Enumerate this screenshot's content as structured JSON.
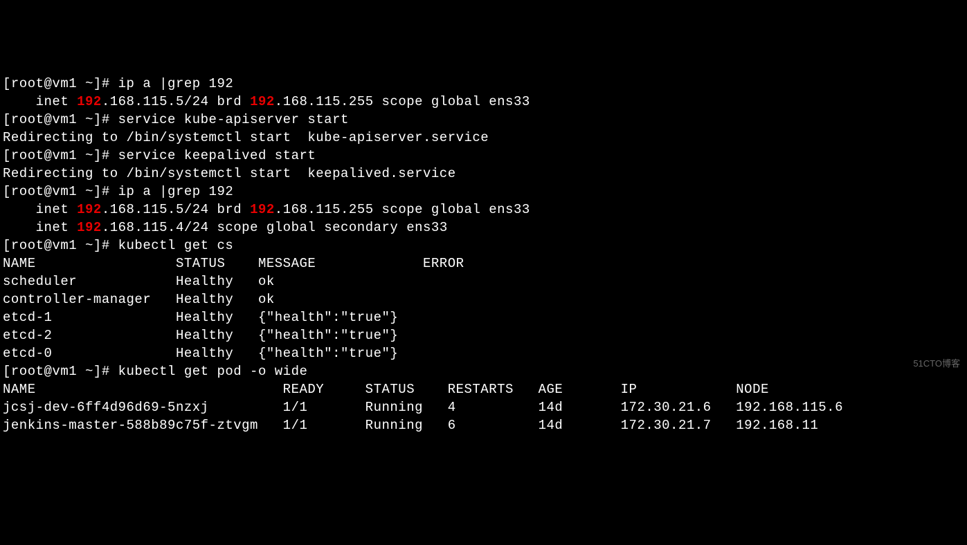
{
  "lines": [
    {
      "segments": [
        {
          "t": "[root@vm1 ~]# ip a |grep 192"
        }
      ]
    },
    {
      "segments": [
        {
          "t": "    inet "
        },
        {
          "t": "192",
          "hl": true
        },
        {
          "t": ".168.115.5/24 brd "
        },
        {
          "t": "192",
          "hl": true
        },
        {
          "t": ".168.115.255 scope global ens33"
        }
      ]
    },
    {
      "segments": [
        {
          "t": "[root@vm1 ~]# service kube-apiserver start"
        }
      ]
    },
    {
      "segments": [
        {
          "t": "Redirecting to /bin/systemctl start  kube-apiserver.service"
        }
      ]
    },
    {
      "segments": [
        {
          "t": "[root@vm1 ~]# service keepalived start"
        }
      ]
    },
    {
      "segments": [
        {
          "t": "Redirecting to /bin/systemctl start  keepalived.service"
        }
      ]
    },
    {
      "segments": [
        {
          "t": "[root@vm1 ~]# ip a |grep 192"
        }
      ]
    },
    {
      "segments": [
        {
          "t": "    inet "
        },
        {
          "t": "192",
          "hl": true
        },
        {
          "t": ".168.115.5/24 brd "
        },
        {
          "t": "192",
          "hl": true
        },
        {
          "t": ".168.115.255 scope global ens33"
        }
      ]
    },
    {
      "segments": [
        {
          "t": "    inet "
        },
        {
          "t": "192",
          "hl": true
        },
        {
          "t": ".168.115.4/24 scope global secondary ens33"
        }
      ]
    },
    {
      "segments": [
        {
          "t": "[root@vm1 ~]# kubectl get cs"
        }
      ]
    },
    {
      "segments": [
        {
          "t": "NAME                 STATUS    MESSAGE             ERROR"
        }
      ]
    },
    {
      "segments": [
        {
          "t": "scheduler            Healthy   ok"
        }
      ]
    },
    {
      "segments": [
        {
          "t": "controller-manager   Healthy   ok"
        }
      ]
    },
    {
      "segments": [
        {
          "t": "etcd-1               Healthy   {\"health\":\"true\"}"
        }
      ]
    },
    {
      "segments": [
        {
          "t": "etcd-2               Healthy   {\"health\":\"true\"}"
        }
      ]
    },
    {
      "segments": [
        {
          "t": "etcd-0               Healthy   {\"health\":\"true\"}"
        }
      ]
    },
    {
      "segments": [
        {
          "t": "[root@vm1 ~]# kubectl get pod -o wide"
        }
      ]
    },
    {
      "segments": [
        {
          "t": "NAME                              READY     STATUS    RESTARTS   AGE       IP            NODE"
        }
      ]
    },
    {
      "segments": [
        {
          "t": "jcsj-dev-6ff4d96d69-5nzxj         1/1       Running   4          14d       172.30.21.6   192.168.115.6"
        }
      ]
    },
    {
      "segments": [
        {
          "t": "jenkins-master-588b89c75f-ztvgm   1/1       Running   6          14d       172.30.21.7   192.168.11"
        }
      ]
    }
  ],
  "watermark": "51CTO博客"
}
